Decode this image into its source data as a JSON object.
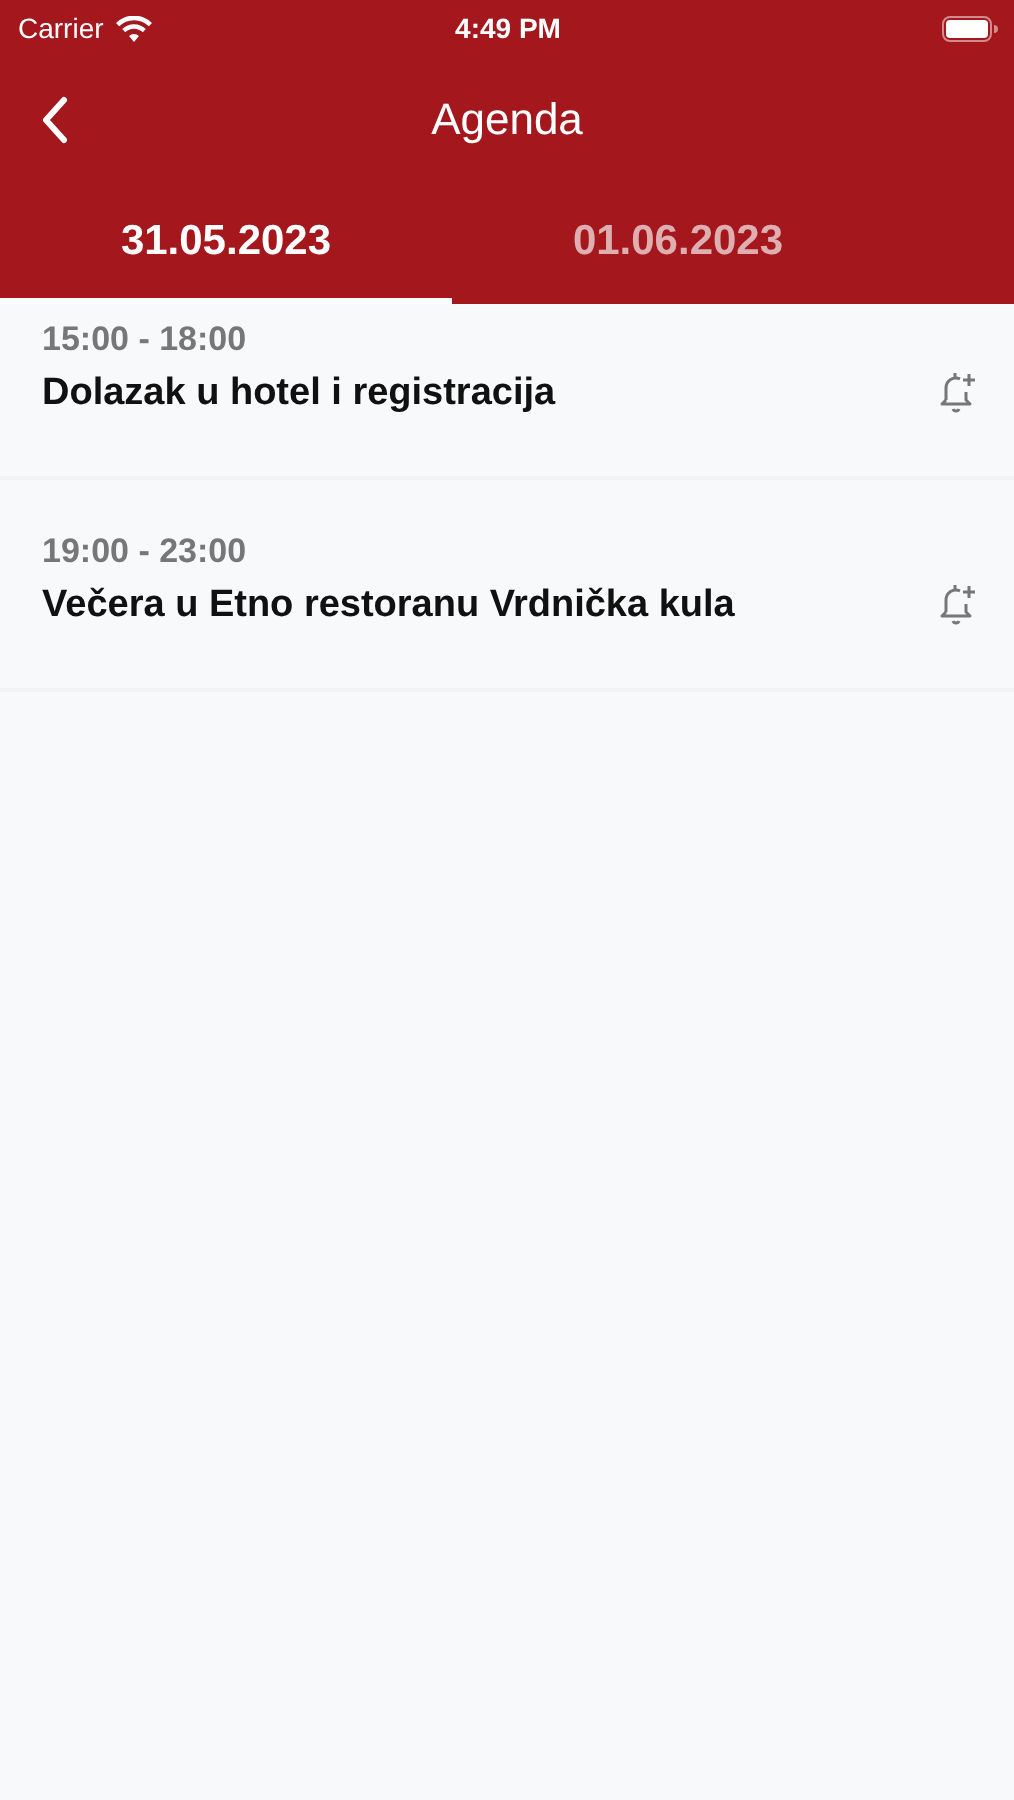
{
  "status_bar": {
    "carrier": "Carrier",
    "time": "4:49 PM"
  },
  "nav": {
    "title": "Agenda"
  },
  "tabs": [
    {
      "label": "31.05.2023",
      "selected": true
    },
    {
      "label": "01.06.2023",
      "selected": false
    }
  ],
  "events": [
    {
      "time": "15:00 - 18:00",
      "title": "Dolazak u hotel i registracija"
    },
    {
      "time": "19:00 - 23:00",
      "title": "Večera u Etno restoranu Vrdnička kula"
    }
  ]
}
